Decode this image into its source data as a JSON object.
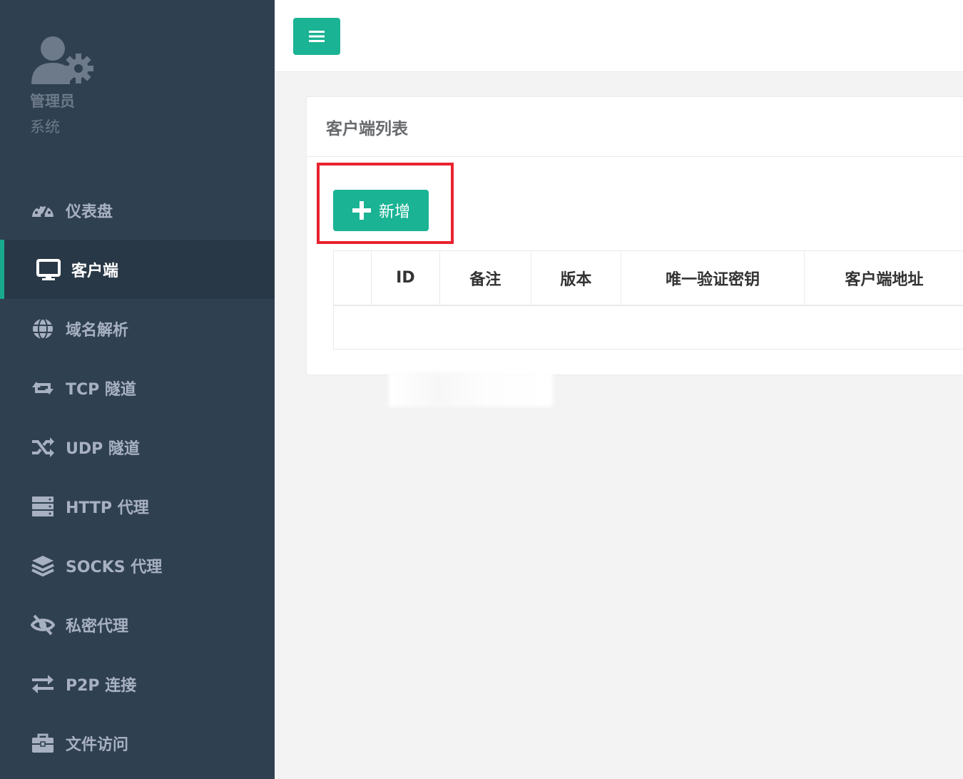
{
  "profile": {
    "name": "管理员",
    "role": "系统",
    "avatar_icon": "user-gear-icon"
  },
  "sidebar": {
    "items": [
      {
        "label": "仪表盘",
        "icon": "dashboard-icon",
        "active": false
      },
      {
        "label": "客户端",
        "icon": "desktop-icon",
        "active": true
      },
      {
        "label": "域名解析",
        "icon": "globe-icon",
        "active": false
      },
      {
        "label": "TCP 隧道",
        "icon": "retweet-icon",
        "active": false
      },
      {
        "label": "UDP 隧道",
        "icon": "random-icon",
        "active": false
      },
      {
        "label": "HTTP 代理",
        "icon": "server-icon",
        "active": false
      },
      {
        "label": "SOCKS 代理",
        "icon": "layers-icon",
        "active": false
      },
      {
        "label": "私密代理",
        "icon": "eye-slash-icon",
        "active": false
      },
      {
        "label": "P2P 连接",
        "icon": "exchange-icon",
        "active": false
      },
      {
        "label": "文件访问",
        "icon": "briefcase-icon",
        "active": false
      }
    ]
  },
  "topbar": {
    "menu_icon": "hamburger-icon"
  },
  "panel": {
    "title": "客户端列表",
    "add_label": "新增"
  },
  "table": {
    "columns": [
      "",
      "ID",
      "备注",
      "版本",
      "唯一验证密钥",
      "客户端地址"
    ],
    "rows": []
  },
  "colors": {
    "sidebar_bg": "#2f4050",
    "sidebar_active_bg": "#293846",
    "accent": "#1ab394",
    "highlight": "#e8232f"
  }
}
